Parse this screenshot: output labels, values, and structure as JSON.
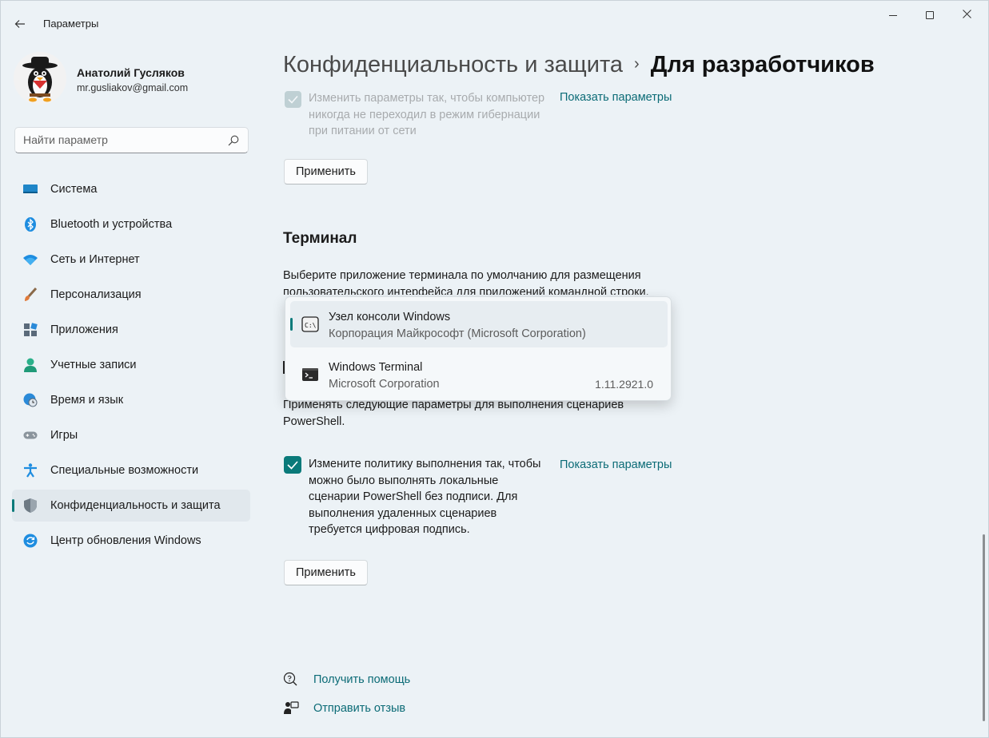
{
  "window": {
    "title": "Параметры",
    "back_icon": "arrow-left-icon",
    "controls": [
      "minimize-icon",
      "maximize-icon",
      "close-icon"
    ]
  },
  "profile": {
    "name": "Анатолий Гусляков",
    "email": "mr.gusliakov@gmail.com"
  },
  "search": {
    "placeholder": "Найти параметр",
    "value": ""
  },
  "sidebar": {
    "items": [
      {
        "label": "Система",
        "icon": "monitor-icon"
      },
      {
        "label": "Bluetooth и устройства",
        "icon": "bluetooth-icon"
      },
      {
        "label": "Сеть и Интернет",
        "icon": "wifi-icon"
      },
      {
        "label": "Персонализация",
        "icon": "brush-icon"
      },
      {
        "label": "Приложения",
        "icon": "apps-icon"
      },
      {
        "label": "Учетные записи",
        "icon": "person-icon"
      },
      {
        "label": "Время и язык",
        "icon": "globe-clock-icon"
      },
      {
        "label": "Игры",
        "icon": "gamepad-icon"
      },
      {
        "label": "Специальные возможности",
        "icon": "accessibility-icon"
      },
      {
        "label": "Конфиденциальность и защита",
        "icon": "shield-icon",
        "active": true
      },
      {
        "label": "Центр обновления Windows",
        "icon": "update-icon"
      }
    ]
  },
  "breadcrumb": {
    "parent": "Конфиденциальность и защита",
    "separator": "›",
    "current": "Для разработчиков"
  },
  "power": {
    "checkbox_text": "Изменить параметры так, чтобы компьютер никогда не переходил в режим гибернации при питании от сети",
    "checked": true,
    "show_params": "Показать параметры",
    "apply": "Применить"
  },
  "terminal": {
    "title": "Терминал",
    "description": "Выберите приложение терминала по умолчанию для размещения пользовательского интерфейса для приложений командной строки.",
    "dropdown": [
      {
        "title": "Узел консоли Windows",
        "subtitle": "Корпорация Майкрософт (Microsoft Corporation)",
        "version": "",
        "icon": "console-host-icon",
        "selected": true
      },
      {
        "title": "Windows Terminal",
        "subtitle": "Microsoft Corporation",
        "version": "1.11.2921.0",
        "icon": "windows-terminal-icon",
        "selected": false
      }
    ]
  },
  "powershell": {
    "description": "Применять следующие параметры для выполнения сценариев PowerShell.",
    "checkbox_text": "Измените политику выполнения так, чтобы можно было выполнять локальные сценарии PowerShell без подписи. Для выполнения удаленных сценариев требуется цифровая подпись.",
    "checked": true,
    "show_params": "Показать параметры",
    "apply": "Применить"
  },
  "footer": {
    "help": "Получить помощь",
    "feedback": "Отправить отзыв"
  },
  "colors": {
    "accent": "#0a7a7a",
    "link": "#0b6b76",
    "background": "#ecf2f6"
  }
}
